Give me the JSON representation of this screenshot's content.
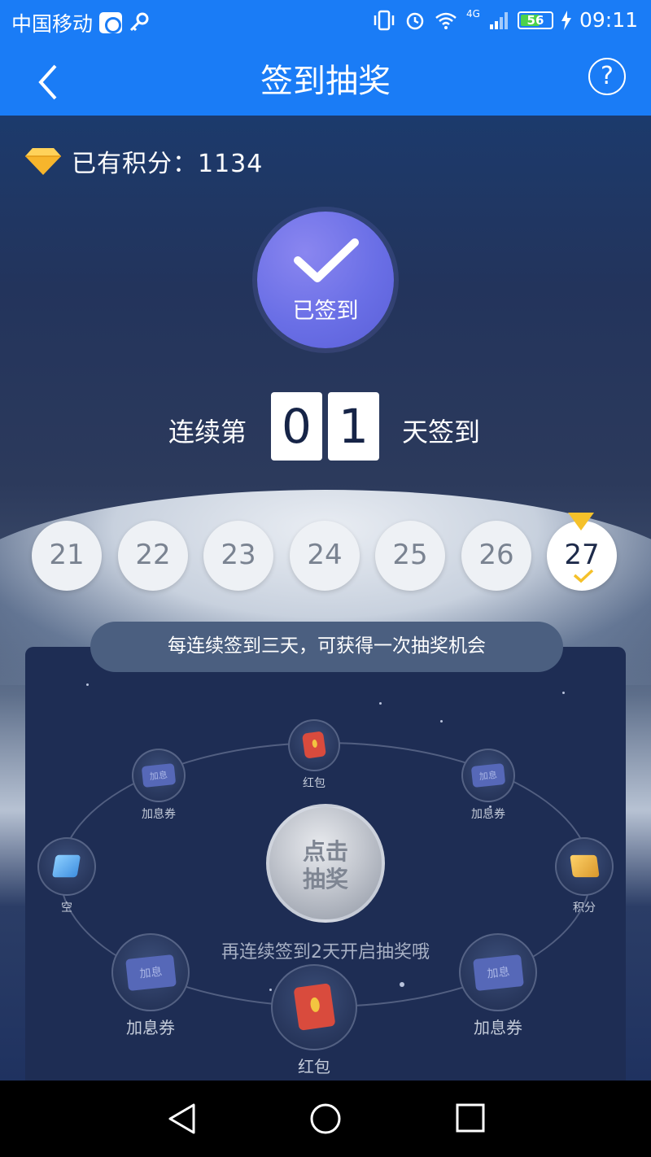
{
  "status_bar": {
    "carrier": "中国移动",
    "network": "4G",
    "battery": "56",
    "time": "09:11"
  },
  "nav": {
    "title": "签到抽奖",
    "help": "?"
  },
  "points": {
    "label": "已有积分：1134"
  },
  "sign_status": {
    "label": "已签到"
  },
  "streak": {
    "prefix": "连续第",
    "digit1": "0",
    "digit2": "1",
    "suffix": "天签到"
  },
  "days": [
    "21",
    "22",
    "23",
    "24",
    "25",
    "26",
    "27"
  ],
  "tip": "每连续签到三天，可获得一次抽奖机会",
  "prizes": {
    "top": "红包",
    "upper_left": "加息券",
    "upper_right": "加息券",
    "left": "空",
    "right": "积分",
    "lower_left": "加息券",
    "lower_right": "加息券",
    "bottom": "红包",
    "ticket_small": "加息",
    "ticket_big": "加息"
  },
  "draw_button": {
    "line1": "点击",
    "line2": "抽奖"
  },
  "reminder": "再连续签到2天开启抽奖哦",
  "colors": {
    "brand": "#1a7cf6",
    "signed_circle": "#6a6fe6",
    "today_marker": "#f5c12a"
  }
}
